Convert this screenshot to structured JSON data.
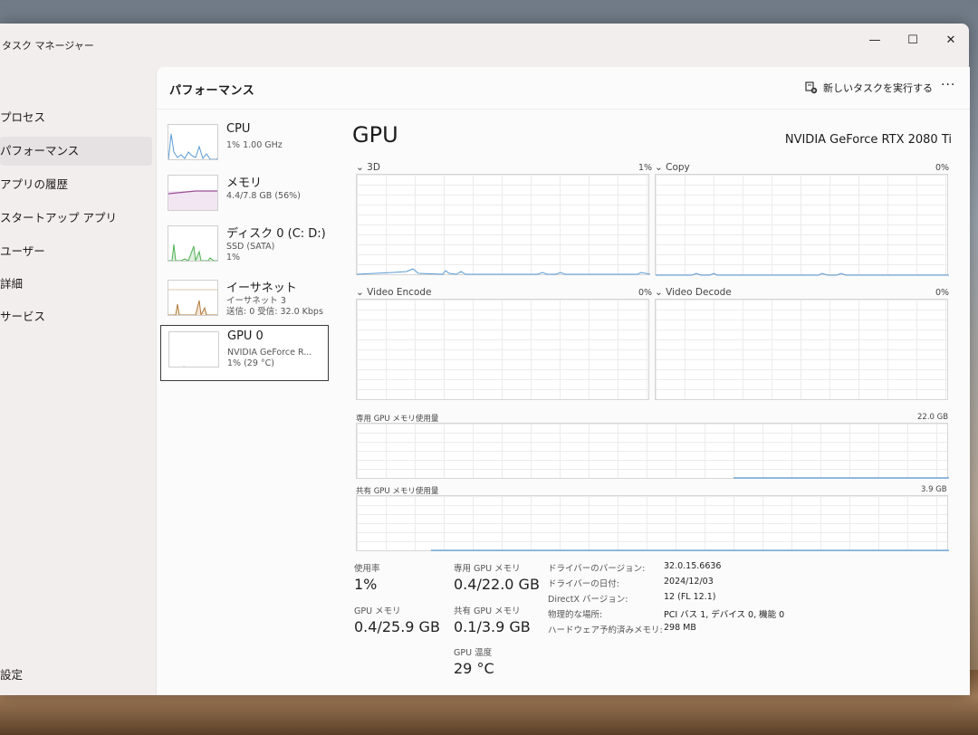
{
  "window": {
    "title": "タスク マネージャー",
    "controls": {
      "minimize": "—",
      "maximize": "☐",
      "close": "✕"
    }
  },
  "nav": {
    "items": [
      {
        "label": "プロセス"
      },
      {
        "label": "パフォーマンス"
      },
      {
        "label": "アプリの履歴"
      },
      {
        "label": "スタートアップ アプリ"
      },
      {
        "label": "ユーザー"
      },
      {
        "label": "詳細"
      },
      {
        "label": "サービス"
      }
    ],
    "settings": "設定"
  },
  "header": {
    "title": "パフォーマンス",
    "run_new_task": "新しいタスクを実行する",
    "more": "···"
  },
  "resources": [
    {
      "name": "CPU",
      "line1": "1%  1.00 GHz",
      "line2": ""
    },
    {
      "name": "メモリ",
      "line1": "4.4/7.8 GB (56%)",
      "line2": ""
    },
    {
      "name": "ディスク 0 (C: D:)",
      "line1": "SSD (SATA)",
      "line2": "1%"
    },
    {
      "name": "イーサネット",
      "line1": "イーサネット 3",
      "line2": "送信: 0 受信: 32.0 Kbps"
    },
    {
      "name": "GPU 0",
      "line1": "NVIDIA GeForce R...",
      "line2": "1% (29 °C)"
    }
  ],
  "gpu": {
    "title": "GPU",
    "model": "NVIDIA GeForce RTX 2080 Ti",
    "engines": [
      {
        "label": "3D",
        "percent": "1%"
      },
      {
        "label": "Copy",
        "percent": "0%"
      },
      {
        "label": "Video Encode",
        "percent": "0%"
      },
      {
        "label": "Video Decode",
        "percent": "0%"
      }
    ],
    "dedicated_memory": {
      "label": "専用 GPU メモリ使用量",
      "max": "22.0 GB"
    },
    "shared_memory": {
      "label": "共有 GPU メモリ使用量",
      "max": "3.9 GB"
    },
    "stats": {
      "utilization_label": "使用率",
      "utilization": "1%",
      "gpu_memory_label": "GPU メモリ",
      "gpu_memory": "0.4/25.9 GB",
      "dedicated_label": "専用 GPU メモリ",
      "dedicated": "0.4/22.0 GB",
      "shared_label": "共有 GPU メモリ",
      "shared": "0.1/3.9 GB",
      "temp_label": "GPU 温度",
      "temp": "29 °C"
    },
    "info": [
      {
        "label": "ドライバーのバージョン:",
        "value": "32.0.15.6636"
      },
      {
        "label": "ドライバーの日付:",
        "value": "2024/12/03"
      },
      {
        "label": "DirectX バージョン:",
        "value": "12 (FL 12.1)"
      },
      {
        "label": "物理的な場所:",
        "value": "PCI バス 1, デバイス 0, 機能 0"
      },
      {
        "label": "ハードウェア予約済みメモリ:",
        "value": "298 MB"
      }
    ]
  },
  "colors": {
    "cpu": "#5b9bd5",
    "memory": "#9b4f96",
    "disk": "#4caf50",
    "ethernet": "#b07a3b",
    "gpu": "#5b9bd5"
  }
}
